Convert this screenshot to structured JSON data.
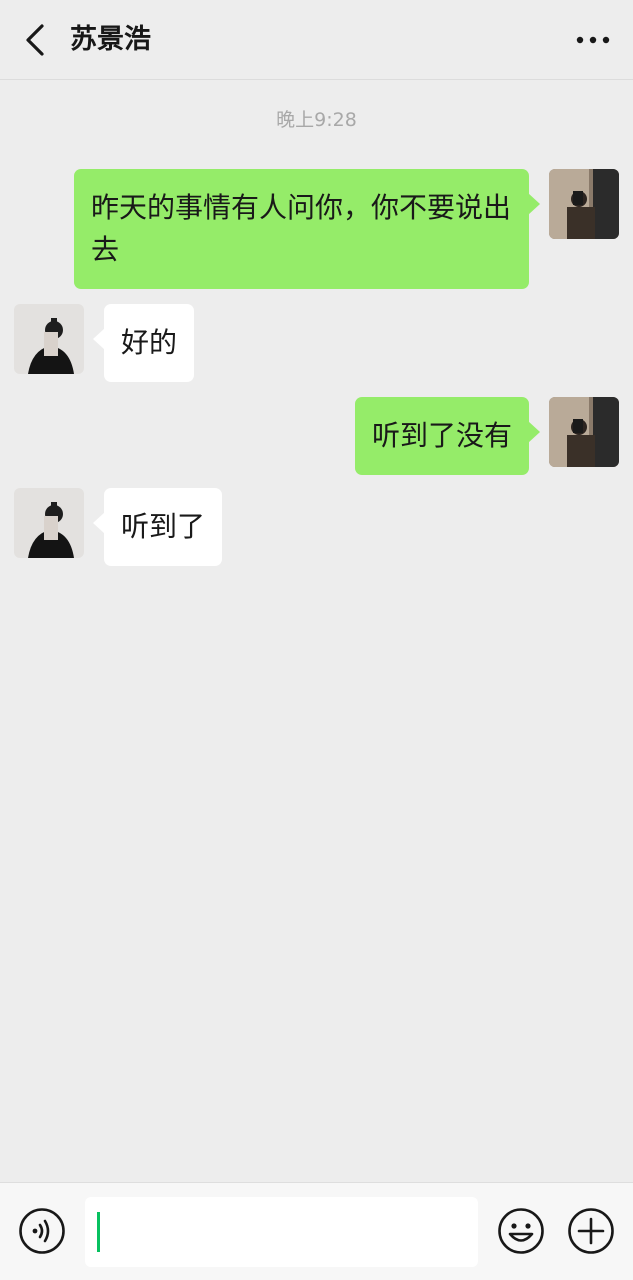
{
  "header": {
    "title": "苏景浩",
    "back_icon": "chevron-left-icon",
    "more_icon": "more-horizontal-icon"
  },
  "timestamp": "晚上9:28",
  "messages": [
    {
      "direction": "sent",
      "text": "昨天的事情有人问你，你不要说出去"
    },
    {
      "direction": "received",
      "text": "好的"
    },
    {
      "direction": "sent",
      "text": "听到了没有"
    },
    {
      "direction": "received",
      "text": "听到了"
    }
  ],
  "input": {
    "value": "",
    "voice_icon": "voice-icon",
    "emoji_icon": "emoji-icon",
    "plus_icon": "plus-icon"
  },
  "colors": {
    "background": "#ededed",
    "sent_bubble": "#95ec69",
    "received_bubble": "#ffffff",
    "cursor": "#07c160"
  }
}
